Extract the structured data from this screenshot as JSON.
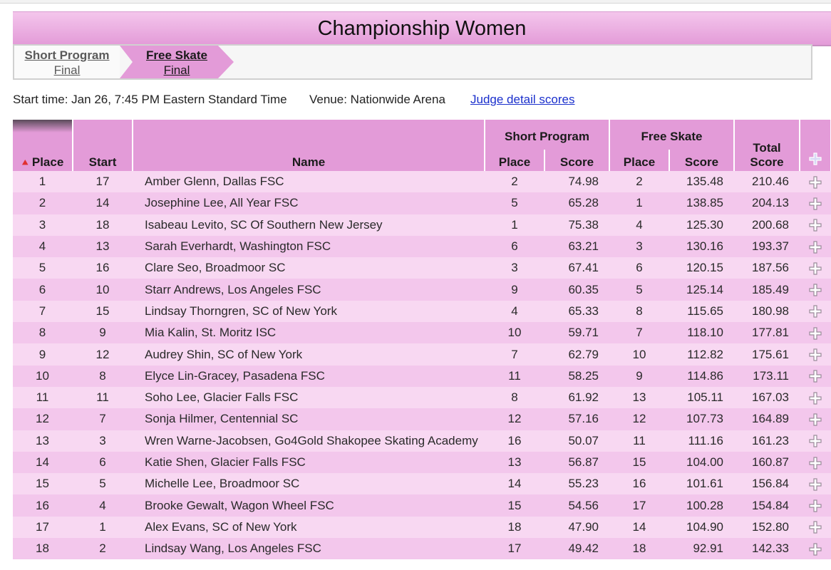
{
  "event": {
    "title": "Championship Women"
  },
  "tabs": [
    {
      "label": "Short Program",
      "sublabel": "Final"
    },
    {
      "label": "Free Skate",
      "sublabel": "Final"
    }
  ],
  "info": {
    "start_time": "Start time: Jan 26, 7:45 PM Eastern Standard Time",
    "venue": "Venue: Nationwide Arena",
    "judge_link": "Judge detail scores"
  },
  "table": {
    "headers": {
      "place": "Place",
      "start": "Start",
      "name": "Name",
      "short_program": "Short Program",
      "free_skate": "Free Skate",
      "sub_place": "Place",
      "sub_score": "Score",
      "total_line1": "Total",
      "total_line2": "Score"
    },
    "rows": [
      {
        "place": "1",
        "start": "17",
        "name": "Amber Glenn, Dallas FSC",
        "sp_place": "2",
        "sp_score": "74.98",
        "fs_place": "2",
        "fs_score": "135.48",
        "total": "210.46"
      },
      {
        "place": "2",
        "start": "14",
        "name": "Josephine Lee, All Year FSC",
        "sp_place": "5",
        "sp_score": "65.28",
        "fs_place": "1",
        "fs_score": "138.85",
        "total": "204.13"
      },
      {
        "place": "3",
        "start": "18",
        "name": "Isabeau Levito, SC Of Southern New Jersey",
        "sp_place": "1",
        "sp_score": "75.38",
        "fs_place": "4",
        "fs_score": "125.30",
        "total": "200.68"
      },
      {
        "place": "4",
        "start": "13",
        "name": "Sarah Everhardt, Washington FSC",
        "sp_place": "6",
        "sp_score": "63.21",
        "fs_place": "3",
        "fs_score": "130.16",
        "total": "193.37"
      },
      {
        "place": "5",
        "start": "16",
        "name": "Clare Seo, Broadmoor SC",
        "sp_place": "3",
        "sp_score": "67.41",
        "fs_place": "6",
        "fs_score": "120.15",
        "total": "187.56"
      },
      {
        "place": "6",
        "start": "10",
        "name": "Starr Andrews, Los Angeles FSC",
        "sp_place": "9",
        "sp_score": "60.35",
        "fs_place": "5",
        "fs_score": "125.14",
        "total": "185.49"
      },
      {
        "place": "7",
        "start": "15",
        "name": "Lindsay Thorngren, SC of New York",
        "sp_place": "4",
        "sp_score": "65.33",
        "fs_place": "8",
        "fs_score": "115.65",
        "total": "180.98"
      },
      {
        "place": "8",
        "start": "9",
        "name": "Mia Kalin, St. Moritz ISC",
        "sp_place": "10",
        "sp_score": "59.71",
        "fs_place": "7",
        "fs_score": "118.10",
        "total": "177.81"
      },
      {
        "place": "9",
        "start": "12",
        "name": "Audrey Shin, SC of New York",
        "sp_place": "7",
        "sp_score": "62.79",
        "fs_place": "10",
        "fs_score": "112.82",
        "total": "175.61"
      },
      {
        "place": "10",
        "start": "8",
        "name": "Elyce Lin-Gracey, Pasadena FSC",
        "sp_place": "11",
        "sp_score": "58.25",
        "fs_place": "9",
        "fs_score": "114.86",
        "total": "173.11"
      },
      {
        "place": "11",
        "start": "11",
        "name": "Soho Lee, Glacier Falls FSC",
        "sp_place": "8",
        "sp_score": "61.92",
        "fs_place": "13",
        "fs_score": "105.11",
        "total": "167.03"
      },
      {
        "place": "12",
        "start": "7",
        "name": "Sonja Hilmer, Centennial SC",
        "sp_place": "12",
        "sp_score": "57.16",
        "fs_place": "12",
        "fs_score": "107.73",
        "total": "164.89"
      },
      {
        "place": "13",
        "start": "3",
        "name": "Wren Warne-Jacobsen, Go4Gold Shakopee Skating Academy",
        "sp_place": "16",
        "sp_score": "50.07",
        "fs_place": "11",
        "fs_score": "111.16",
        "total": "161.23"
      },
      {
        "place": "14",
        "start": "6",
        "name": "Katie Shen, Glacier Falls FSC",
        "sp_place": "13",
        "sp_score": "56.87",
        "fs_place": "15",
        "fs_score": "104.00",
        "total": "160.87"
      },
      {
        "place": "15",
        "start": "5",
        "name": "Michelle Lee, Broadmoor SC",
        "sp_place": "14",
        "sp_score": "55.23",
        "fs_place": "16",
        "fs_score": "101.61",
        "total": "156.84"
      },
      {
        "place": "16",
        "start": "4",
        "name": "Brooke Gewalt, Wagon Wheel FSC",
        "sp_place": "15",
        "sp_score": "54.56",
        "fs_place": "17",
        "fs_score": "100.28",
        "total": "154.84"
      },
      {
        "place": "17",
        "start": "1",
        "name": "Alex Evans, SC of New York",
        "sp_place": "18",
        "sp_score": "47.90",
        "fs_place": "14",
        "fs_score": "104.90",
        "total": "152.80"
      },
      {
        "place": "18",
        "start": "2",
        "name": "Lindsay Wang, Los Angeles FSC",
        "sp_place": "17",
        "sp_score": "49.42",
        "fs_place": "18",
        "fs_score": "92.91",
        "total": "142.33"
      }
    ]
  },
  "icons": {
    "sort": "sort-ascending-icon",
    "expand": "plus-expand-icon"
  },
  "colors": {
    "header_pink": "#e39bd8",
    "row_light": "#f8d8f2",
    "row_dark": "#f3c7ec",
    "link_blue": "#1a2fcc",
    "sort_red": "#e03030"
  }
}
